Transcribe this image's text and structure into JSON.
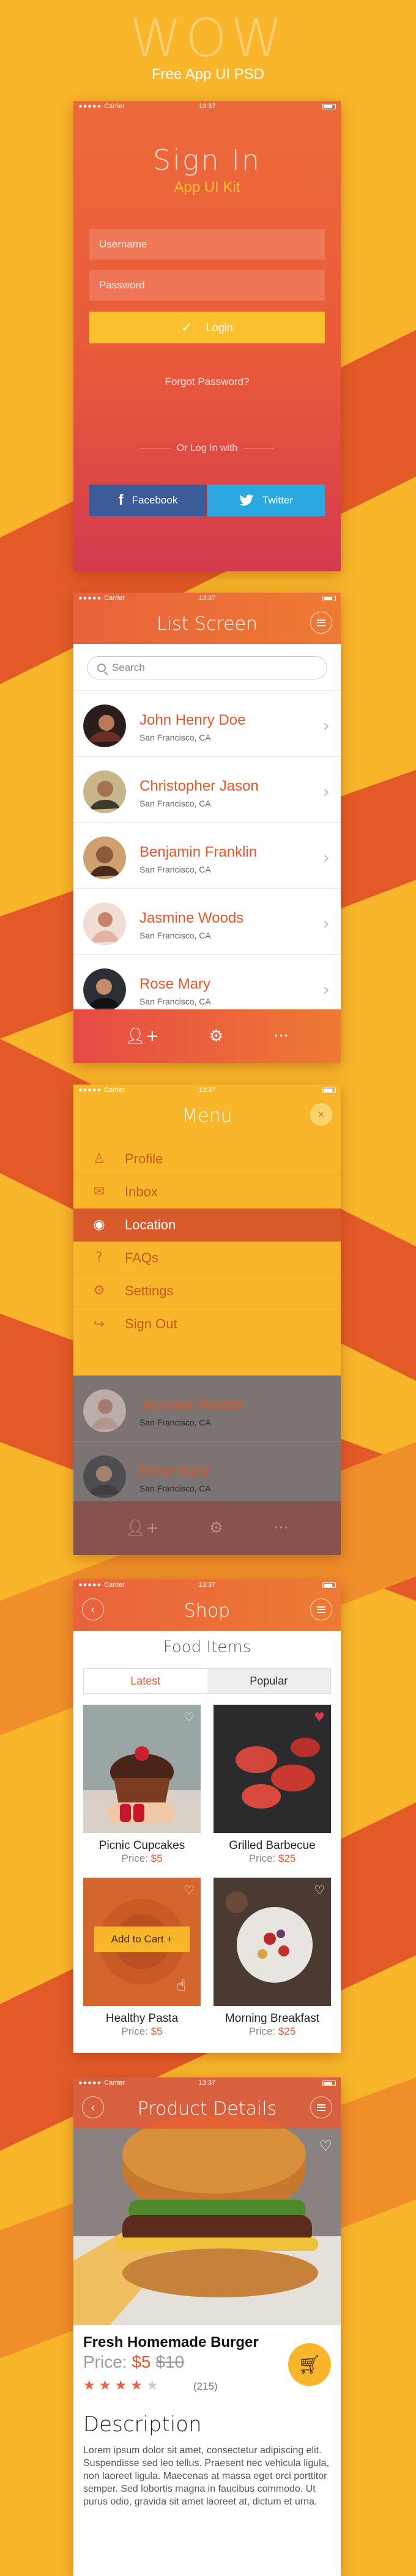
{
  "header": {
    "title": "WOW",
    "subtitle": "Free App UI PSD"
  },
  "status": {
    "dots": "●●●●●",
    "carrier": "Carrier",
    "time": "13:37"
  },
  "signin": {
    "title": "Sign  In",
    "subtitle": "App UI Kit",
    "username_placeholder": "Username",
    "password_placeholder": "Password",
    "login_label": "Login",
    "forgot_label": "Forgot Password?",
    "or_label": "Or Log In with",
    "facebook_label": "Facebook",
    "twitter_label": "Twitter"
  },
  "list": {
    "title": "List Screen",
    "search_placeholder": "Search",
    "contacts": [
      {
        "name": "John Henry Doe",
        "location": "San Francisco, CA"
      },
      {
        "name": "Christopher Jason",
        "location": "San Francisco, CA"
      },
      {
        "name": "Benjamin Franklin",
        "location": "San Francisco, CA"
      },
      {
        "name": "Jasmine Woods",
        "location": "San Francisco, CA"
      },
      {
        "name": "Rose Mary",
        "location": "San Francisco, CA"
      }
    ]
  },
  "menu": {
    "title": "Menu",
    "close": "×",
    "items": [
      {
        "label": "Profile",
        "icon": "person-icon"
      },
      {
        "label": "Inbox",
        "icon": "envelope-icon"
      },
      {
        "label": "Location",
        "icon": "location-pin-icon",
        "active": true
      },
      {
        "label": "FAQs",
        "icon": "question-icon"
      },
      {
        "label": "Settings",
        "icon": "gear-icon"
      },
      {
        "label": "Sign Out",
        "icon": "share-icon"
      }
    ],
    "contacts": [
      {
        "name": "Jasmine Woods",
        "location": "San Francisco, CA"
      },
      {
        "name": "Rose Mary",
        "location": "San Francisco, CA"
      }
    ]
  },
  "shop": {
    "title": "Shop",
    "section": "Food Items",
    "tabs": [
      "Latest",
      "Popular"
    ],
    "add_to_cart": "Add to Cart +",
    "price_prefix": "Price:",
    "products": [
      {
        "name": "Picnic Cupcakes",
        "price": "$5"
      },
      {
        "name": "Grilled Barbecue",
        "price": "$25"
      },
      {
        "name": "Healthy Pasta",
        "price": "$5"
      },
      {
        "name": "Morning Breakfast",
        "price": "$25"
      }
    ]
  },
  "product": {
    "title": "Product Details",
    "name": "Fresh Homemade Burger",
    "price_prefix": "Price:",
    "price": "$5",
    "old_price": "$10",
    "rating": 4,
    "reviews": "(215)",
    "description_title": "Description",
    "description": "Lorem ipsum dolor sit amet, consectetur adipiscing elit. Suspendisse sed leo tellus. Praesent nec vehicula ligula, non laoreet ligula. Maecenas at massa eget orci porttitor semper. Sed lobortis magna in faucibus commodo. Ut purus odio, gravida sit amet laoreet at, dictum et urna."
  },
  "colors": {
    "accent": "#e8623c",
    "yellow": "#f9b62a",
    "facebook": "#3b5b99",
    "twitter": "#2aa9e0"
  }
}
